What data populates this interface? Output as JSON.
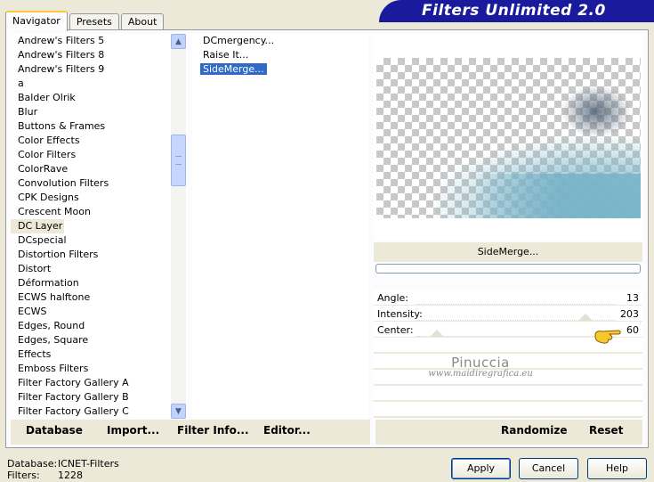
{
  "tabs": [
    "Navigator",
    "Presets",
    "About"
  ],
  "banner_title": "Filters Unlimited 2.0",
  "categories": [
    "Andrew's Filters 5",
    "Andrew's Filters 8",
    "Andrew's Filters 9",
    "a",
    "Balder Olrik",
    "Blur",
    "Buttons & Frames",
    "Color Effects",
    "Color Filters",
    "ColorRave",
    "Convolution Filters",
    "CPK Designs",
    "Crescent Moon",
    "DC Layer",
    "DCspecial",
    "Distortion Filters",
    "Distort",
    "Déformation",
    "ECWS halftone",
    "ECWS",
    "Edges, Round",
    "Edges, Square",
    "Effects",
    "Emboss Filters",
    "Filter Factory Gallery A",
    "Filter Factory Gallery B",
    "Filter Factory Gallery C"
  ],
  "filters": [
    "DCmergency...",
    "Raise It...",
    "SideMerge..."
  ],
  "selected_filter_name": "SideMerge...",
  "params": [
    {
      "label": "Angle:",
      "value": "13"
    },
    {
      "label": "Intensity:",
      "value": "203"
    },
    {
      "label": "Center:",
      "value": "60"
    }
  ],
  "watermark": {
    "line1": "Pinuccia",
    "line2": "www.maidiregrafica.eu"
  },
  "left_buttons": [
    "Database",
    "Import...",
    "Filter Info...",
    "Editor..."
  ],
  "right_buttons": [
    "Randomize",
    "Reset"
  ],
  "status": {
    "database_label": "Database:",
    "database_value": "ICNET-Filters",
    "filters_label": "Filters:",
    "filters_value": "1228"
  },
  "dialog_buttons": {
    "apply": "Apply",
    "cancel": "Cancel",
    "help": "Help"
  },
  "colors": {
    "banner": "#1a1a9c",
    "selection": "#316ac5",
    "face": "#ece9d8"
  }
}
